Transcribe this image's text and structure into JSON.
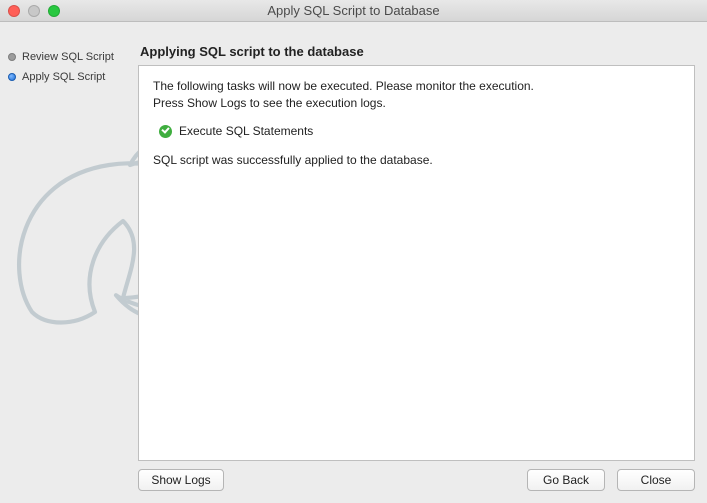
{
  "window": {
    "title": "Apply SQL Script to Database"
  },
  "sidebar": {
    "steps": [
      {
        "label": "Review SQL Script",
        "state": "done"
      },
      {
        "label": "Apply SQL Script",
        "state": "active"
      }
    ]
  },
  "main": {
    "heading": "Applying SQL script to the database",
    "intro_line1": "The following tasks will now be executed. Please monitor the execution.",
    "intro_line2": "Press Show Logs to see the execution logs.",
    "task_label": "Execute SQL Statements",
    "result_message": "SQL script was successfully applied to the database."
  },
  "buttons": {
    "show_logs": "Show Logs",
    "go_back": "Go Back",
    "close": "Close"
  }
}
